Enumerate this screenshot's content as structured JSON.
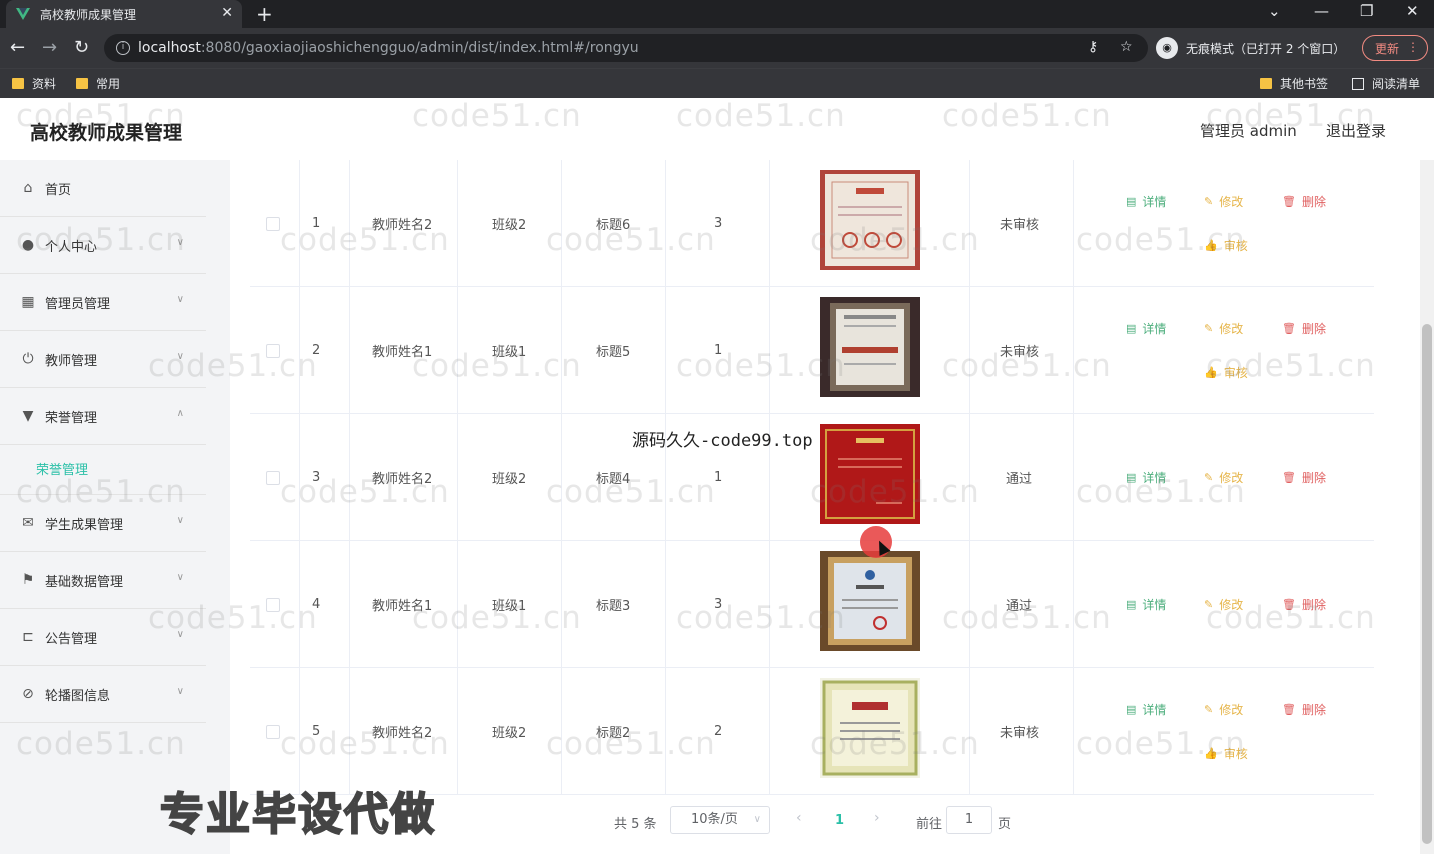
{
  "browser": {
    "tab_title": "高校教师成果管理",
    "url_host": "localhost",
    "url_path": ":8080/gaoxiaojiaoshichengguo/admin/dist/index.html#/rongyu",
    "incognito_label": "无痕模式（已打开 2 个窗口）",
    "update_label": "更新",
    "bookmarks": [
      "资料",
      "常用"
    ],
    "bookmarks_right": [
      "其他书签",
      "阅读清单"
    ]
  },
  "header": {
    "brand": "高校教师成果管理",
    "user": "管理员 admin",
    "logout": "退出登录"
  },
  "sidebar": {
    "items": [
      {
        "label": "首页",
        "icon": "home-icon"
      },
      {
        "label": "个人中心",
        "icon": "user-icon"
      },
      {
        "label": "管理员管理",
        "icon": "grid-icon"
      },
      {
        "label": "教师管理",
        "icon": "power-icon"
      },
      {
        "label": "荣誉管理",
        "icon": "badge-icon"
      },
      {
        "label": "学生成果管理",
        "icon": "mail-icon"
      },
      {
        "label": "基础数据管理",
        "icon": "flag-icon"
      },
      {
        "label": "公告管理",
        "icon": "crop-icon"
      },
      {
        "label": "轮播图信息",
        "icon": "bell-off-icon"
      }
    ],
    "submenu": "荣誉管理"
  },
  "table": {
    "rows": [
      {
        "index": "1",
        "teacher": "教师姓名2",
        "class": "班级2",
        "title": "标题6",
        "count": "3",
        "status": "未审核",
        "audit": true
      },
      {
        "index": "2",
        "teacher": "教师姓名1",
        "class": "班级1",
        "title": "标题5",
        "count": "1",
        "status": "未审核",
        "audit": true
      },
      {
        "index": "3",
        "teacher": "教师姓名2",
        "class": "班级2",
        "title": "标题4",
        "count": "1",
        "status": "通过",
        "audit": false
      },
      {
        "index": "4",
        "teacher": "教师姓名1",
        "class": "班级1",
        "title": "标题3",
        "count": "3",
        "status": "通过",
        "audit": false
      },
      {
        "index": "5",
        "teacher": "教师姓名2",
        "class": "班级2",
        "title": "标题2",
        "count": "2",
        "status": "未审核",
        "audit": true
      }
    ],
    "actions": {
      "detail": "详情",
      "edit": "修改",
      "delete": "删除",
      "audit": "审核"
    }
  },
  "pagination": {
    "total": "共 5 条",
    "page_size": "10条/页",
    "current": "1",
    "goto": "前往",
    "goto_value": "1",
    "page_unit": "页"
  },
  "overlay": {
    "watermark": "code51.cn",
    "source_text": "源码久久-code99.top",
    "promo_text": "专业毕设代做"
  },
  "colors": {
    "accent": "#2bc0a8",
    "detail": "#4cae7c",
    "edit": "#e6b54a",
    "delete": "#e06060"
  }
}
